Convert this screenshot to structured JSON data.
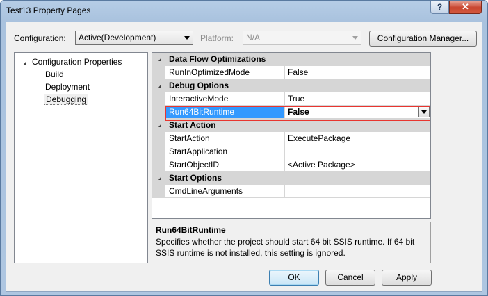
{
  "window": {
    "title": "Test13 Property Pages",
    "help_label": "?",
    "close_label": "✕"
  },
  "toolbar": {
    "configuration_label": "Configuration:",
    "configuration_value": "Active(Development)",
    "platform_label": "Platform:",
    "platform_value": "N/A",
    "config_manager_label": "Configuration Manager..."
  },
  "tree": {
    "root": "Configuration Properties",
    "items": [
      "Build",
      "Deployment",
      "Debugging"
    ],
    "selected": "Debugging"
  },
  "grid": {
    "categories": [
      {
        "name": "Data Flow Optimizations",
        "props": [
          {
            "name": "RunInOptimizedMode",
            "value": "False"
          }
        ]
      },
      {
        "name": "Debug Options",
        "props": [
          {
            "name": "InteractiveMode",
            "value": "True"
          },
          {
            "name": "Run64BitRuntime",
            "value": "False"
          }
        ]
      },
      {
        "name": "Start Action",
        "props": [
          {
            "name": "StartAction",
            "value": "ExecutePackage"
          },
          {
            "name": "StartApplication",
            "value": ""
          },
          {
            "name": "StartObjectID",
            "value": "<Active Package>"
          }
        ]
      },
      {
        "name": "Start Options",
        "props": [
          {
            "name": "CmdLineArguments",
            "value": ""
          }
        ]
      }
    ],
    "selected_property": "Run64BitRuntime",
    "highlight_color": "#e8352f",
    "selection_color": "#3399ff"
  },
  "description": {
    "title": "Run64BitRuntime",
    "text": "Specifies whether the project should start 64 bit SSIS runtime. If 64 bit SSIS runtime is not installed, this setting is ignored."
  },
  "buttons": {
    "ok": "OK",
    "cancel": "Cancel",
    "apply": "Apply"
  }
}
